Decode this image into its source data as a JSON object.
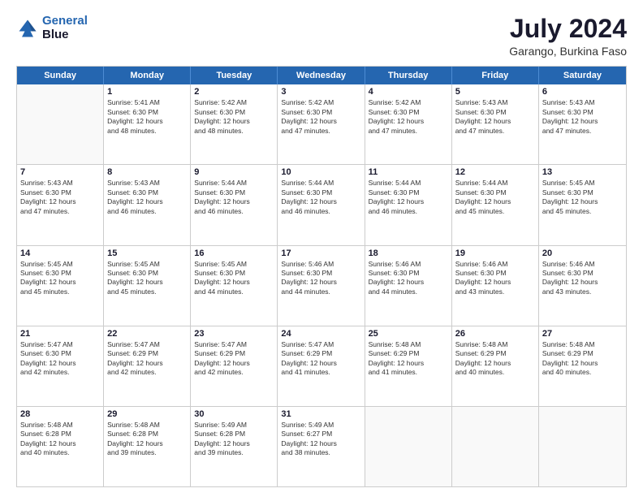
{
  "logo": {
    "line1": "General",
    "line2": "Blue"
  },
  "title": "July 2024",
  "subtitle": "Garango, Burkina Faso",
  "header_days": [
    "Sunday",
    "Monday",
    "Tuesday",
    "Wednesday",
    "Thursday",
    "Friday",
    "Saturday"
  ],
  "weeks": [
    [
      {
        "day": "",
        "lines": []
      },
      {
        "day": "1",
        "lines": [
          "Sunrise: 5:41 AM",
          "Sunset: 6:30 PM",
          "Daylight: 12 hours",
          "and 48 minutes."
        ]
      },
      {
        "day": "2",
        "lines": [
          "Sunrise: 5:42 AM",
          "Sunset: 6:30 PM",
          "Daylight: 12 hours",
          "and 48 minutes."
        ]
      },
      {
        "day": "3",
        "lines": [
          "Sunrise: 5:42 AM",
          "Sunset: 6:30 PM",
          "Daylight: 12 hours",
          "and 47 minutes."
        ]
      },
      {
        "day": "4",
        "lines": [
          "Sunrise: 5:42 AM",
          "Sunset: 6:30 PM",
          "Daylight: 12 hours",
          "and 47 minutes."
        ]
      },
      {
        "day": "5",
        "lines": [
          "Sunrise: 5:43 AM",
          "Sunset: 6:30 PM",
          "Daylight: 12 hours",
          "and 47 minutes."
        ]
      },
      {
        "day": "6",
        "lines": [
          "Sunrise: 5:43 AM",
          "Sunset: 6:30 PM",
          "Daylight: 12 hours",
          "and 47 minutes."
        ]
      }
    ],
    [
      {
        "day": "7",
        "lines": [
          "Sunrise: 5:43 AM",
          "Sunset: 6:30 PM",
          "Daylight: 12 hours",
          "and 47 minutes."
        ]
      },
      {
        "day": "8",
        "lines": [
          "Sunrise: 5:43 AM",
          "Sunset: 6:30 PM",
          "Daylight: 12 hours",
          "and 46 minutes."
        ]
      },
      {
        "day": "9",
        "lines": [
          "Sunrise: 5:44 AM",
          "Sunset: 6:30 PM",
          "Daylight: 12 hours",
          "and 46 minutes."
        ]
      },
      {
        "day": "10",
        "lines": [
          "Sunrise: 5:44 AM",
          "Sunset: 6:30 PM",
          "Daylight: 12 hours",
          "and 46 minutes."
        ]
      },
      {
        "day": "11",
        "lines": [
          "Sunrise: 5:44 AM",
          "Sunset: 6:30 PM",
          "Daylight: 12 hours",
          "and 46 minutes."
        ]
      },
      {
        "day": "12",
        "lines": [
          "Sunrise: 5:44 AM",
          "Sunset: 6:30 PM",
          "Daylight: 12 hours",
          "and 45 minutes."
        ]
      },
      {
        "day": "13",
        "lines": [
          "Sunrise: 5:45 AM",
          "Sunset: 6:30 PM",
          "Daylight: 12 hours",
          "and 45 minutes."
        ]
      }
    ],
    [
      {
        "day": "14",
        "lines": [
          "Sunrise: 5:45 AM",
          "Sunset: 6:30 PM",
          "Daylight: 12 hours",
          "and 45 minutes."
        ]
      },
      {
        "day": "15",
        "lines": [
          "Sunrise: 5:45 AM",
          "Sunset: 6:30 PM",
          "Daylight: 12 hours",
          "and 45 minutes."
        ]
      },
      {
        "day": "16",
        "lines": [
          "Sunrise: 5:45 AM",
          "Sunset: 6:30 PM",
          "Daylight: 12 hours",
          "and 44 minutes."
        ]
      },
      {
        "day": "17",
        "lines": [
          "Sunrise: 5:46 AM",
          "Sunset: 6:30 PM",
          "Daylight: 12 hours",
          "and 44 minutes."
        ]
      },
      {
        "day": "18",
        "lines": [
          "Sunrise: 5:46 AM",
          "Sunset: 6:30 PM",
          "Daylight: 12 hours",
          "and 44 minutes."
        ]
      },
      {
        "day": "19",
        "lines": [
          "Sunrise: 5:46 AM",
          "Sunset: 6:30 PM",
          "Daylight: 12 hours",
          "and 43 minutes."
        ]
      },
      {
        "day": "20",
        "lines": [
          "Sunrise: 5:46 AM",
          "Sunset: 6:30 PM",
          "Daylight: 12 hours",
          "and 43 minutes."
        ]
      }
    ],
    [
      {
        "day": "21",
        "lines": [
          "Sunrise: 5:47 AM",
          "Sunset: 6:30 PM",
          "Daylight: 12 hours",
          "and 42 minutes."
        ]
      },
      {
        "day": "22",
        "lines": [
          "Sunrise: 5:47 AM",
          "Sunset: 6:29 PM",
          "Daylight: 12 hours",
          "and 42 minutes."
        ]
      },
      {
        "day": "23",
        "lines": [
          "Sunrise: 5:47 AM",
          "Sunset: 6:29 PM",
          "Daylight: 12 hours",
          "and 42 minutes."
        ]
      },
      {
        "day": "24",
        "lines": [
          "Sunrise: 5:47 AM",
          "Sunset: 6:29 PM",
          "Daylight: 12 hours",
          "and 41 minutes."
        ]
      },
      {
        "day": "25",
        "lines": [
          "Sunrise: 5:48 AM",
          "Sunset: 6:29 PM",
          "Daylight: 12 hours",
          "and 41 minutes."
        ]
      },
      {
        "day": "26",
        "lines": [
          "Sunrise: 5:48 AM",
          "Sunset: 6:29 PM",
          "Daylight: 12 hours",
          "and 40 minutes."
        ]
      },
      {
        "day": "27",
        "lines": [
          "Sunrise: 5:48 AM",
          "Sunset: 6:29 PM",
          "Daylight: 12 hours",
          "and 40 minutes."
        ]
      }
    ],
    [
      {
        "day": "28",
        "lines": [
          "Sunrise: 5:48 AM",
          "Sunset: 6:28 PM",
          "Daylight: 12 hours",
          "and 40 minutes."
        ]
      },
      {
        "day": "29",
        "lines": [
          "Sunrise: 5:48 AM",
          "Sunset: 6:28 PM",
          "Daylight: 12 hours",
          "and 39 minutes."
        ]
      },
      {
        "day": "30",
        "lines": [
          "Sunrise: 5:49 AM",
          "Sunset: 6:28 PM",
          "Daylight: 12 hours",
          "and 39 minutes."
        ]
      },
      {
        "day": "31",
        "lines": [
          "Sunrise: 5:49 AM",
          "Sunset: 6:27 PM",
          "Daylight: 12 hours",
          "and 38 minutes."
        ]
      },
      {
        "day": "",
        "lines": []
      },
      {
        "day": "",
        "lines": []
      },
      {
        "day": "",
        "lines": []
      }
    ]
  ]
}
